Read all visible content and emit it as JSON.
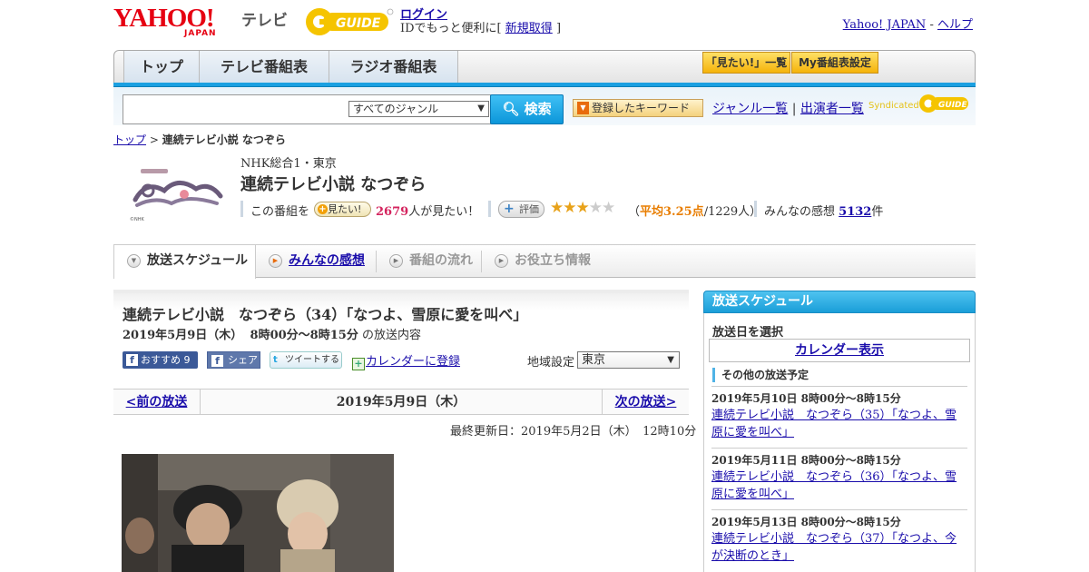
{
  "header": {
    "yahoo_logo": "YAHOO!",
    "yahoo_sub": "JAPAN",
    "tv_label": "テレビ",
    "login": "ログイン",
    "login_sub_prefix": "IDでもっと便利に[",
    "signup": "新規取得",
    "login_sub_suffix": "]",
    "yahoo_japan_link": "Yahoo! JAPAN",
    "dash": "-",
    "help_link": "ヘルプ"
  },
  "nav": {
    "tabs": [
      {
        "label": "トップ"
      },
      {
        "label": "テレビ番組表"
      },
      {
        "label": "ラジオ番組表"
      }
    ],
    "want_list_btn": "「見たい!」一覧",
    "my_schedule_btn": "My番組表設定"
  },
  "search": {
    "input_value": "",
    "genre_selected": "すべてのジャンル",
    "search_btn": "検索",
    "keywords_btn": "登録したキーワード",
    "genre_list_link": "ジャンル一覧",
    "separator": "|",
    "performers_link": "出演者一覧",
    "syndicated": "Syndicated"
  },
  "breadcrumb": {
    "top": "トップ",
    "sep": ">",
    "current": "連続テレビ小説 なつぞら"
  },
  "program": {
    "channel": "NHK総合1・東京",
    "title": "連続テレビ小説 なつぞら",
    "want_prefix": "この番組を",
    "want_btn": "見たい!",
    "want_count": "2679",
    "want_suffix": "人が見たい！",
    "rate_btn": "評価",
    "rating": 3.25,
    "stars_on": "★★★",
    "stars_off": "★★",
    "avg_open": "（",
    "avg_value": "平均3.25点",
    "avg_count": "/1229人）",
    "impressions_prefix": "みんなの感想",
    "impressions_count": "5132",
    "impressions_suffix": "件"
  },
  "tabs": [
    {
      "label": "放送スケジュール",
      "state": "active"
    },
    {
      "label": "みんなの感想",
      "state": "link"
    },
    {
      "label": "番組の流れ",
      "state": "disabled"
    },
    {
      "label": "お役立ち情報",
      "state": "disabled"
    }
  ],
  "episode": {
    "title": "連続テレビ小説　なつぞら（34）「なつよ、雪原に愛を叫べ」",
    "date": "2019年5月9日（木）",
    "time": "8時00分～8時15分",
    "date_suffix": "の放送内容",
    "recommend_btn": "おすすめ",
    "recommend_count": "9",
    "share_btn": "シェア",
    "tweet_btn": "ツイートする",
    "calendar_register": "カレンダーに登録",
    "region_label": "地域設定",
    "region_value": "東京"
  },
  "pager": {
    "prev": "<前の放送",
    "current": "2019年5月9日（木）",
    "next": "次の放送>"
  },
  "updated": "最終更新日：2019年5月2日（木）　12時10分",
  "sidebar": {
    "heading": "放送スケジュール",
    "select_day": "放送日を選択",
    "calendar_btn": "カレンダー表示",
    "other_heading": "その他の放送予定",
    "items": [
      {
        "date": "2019年5月10日  8時00分～8時15分",
        "title": "連続テレビ小説　なつぞら（35）「なつよ、雪原に愛を叫べ」"
      },
      {
        "date": "2019年5月11日  8時00分～8時15分",
        "title": "連続テレビ小説　なつぞら（36）「なつよ、雪原に愛を叫べ」"
      },
      {
        "date": "2019年5月13日  8時00分～8時15分",
        "title": "連続テレビ小説　なつぞら（37）「なつよ、今が決断のとき」"
      }
    ]
  },
  "colors": {
    "accent_blue": "#1ba0e1",
    "yahoo_red": "#e60012",
    "link": "#1a0dab",
    "star": "#e8a21a"
  }
}
